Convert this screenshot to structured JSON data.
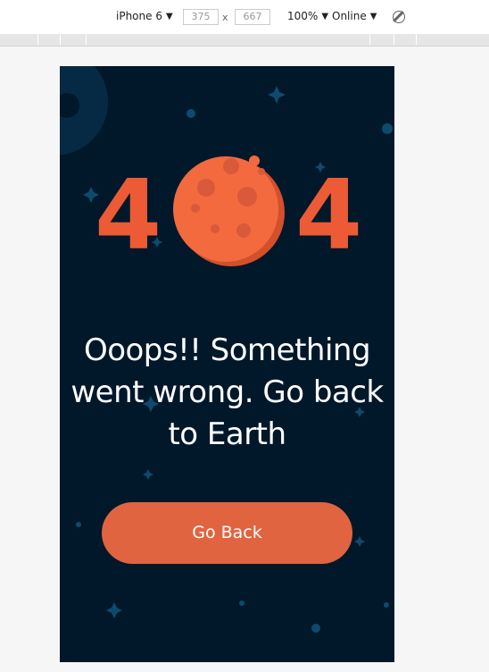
{
  "devtools": {
    "device_name": "iPhone 6",
    "width_value": "375",
    "height_value": "667",
    "dimension_separator": "x",
    "zoom": "100%",
    "network": "Online",
    "caret": "▼"
  },
  "page": {
    "error_digit_left": "4",
    "error_digit_right": "4",
    "message": "Ooops!! Something went wrong. Go back to Earth",
    "button_label": "Go Back"
  },
  "colors": {
    "background": "#01182a",
    "accent": "#ec5b35",
    "button": "#e06440",
    "star": "#0e4a6e"
  }
}
